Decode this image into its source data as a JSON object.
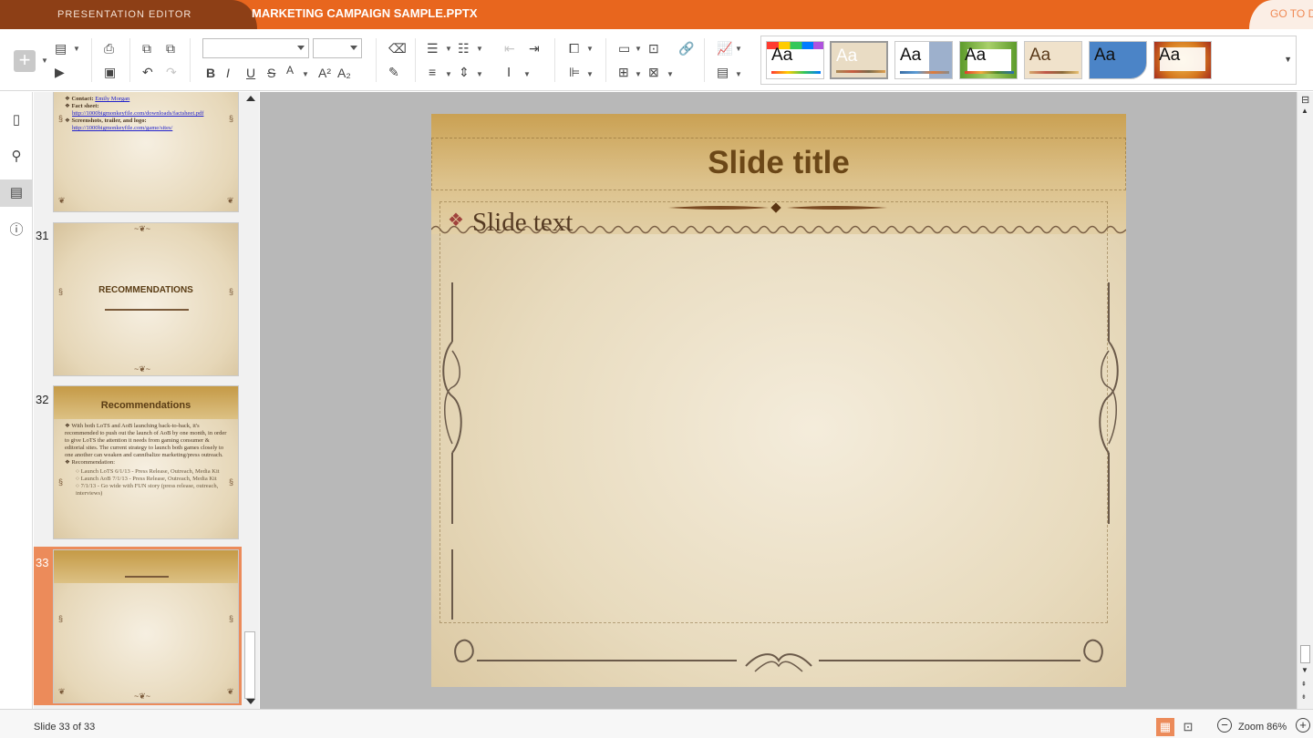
{
  "app": {
    "name": "PRESENTATION EDITOR",
    "document_title": "MARKETING CAMPAIGN SAMPLE.PPTX",
    "goto_label": "GO TO DOCUMENTS"
  },
  "toolbar": {
    "icons": [
      "add-slide",
      "select-layout",
      "start-slideshow",
      "print",
      "save",
      "copy",
      "paste",
      "undo",
      "redo",
      "bold",
      "italic",
      "underline",
      "strikethrough",
      "superscript",
      "subscript",
      "clear-style",
      "copy-style",
      "bullets",
      "numbering",
      "decrease-indent",
      "increase-indent",
      "align-left",
      "vertical-align",
      "line-spacing",
      "shape",
      "text-box",
      "hyperlink",
      "arrange",
      "align-shape",
      "table",
      "image",
      "chart",
      "slide-size"
    ],
    "font_name": "",
    "font_size": ""
  },
  "themes": [
    {
      "label": "Aa",
      "name": "blank",
      "bg": "#ffffff",
      "accent": "#ff3b30"
    },
    {
      "label": "Aa",
      "name": "pixel",
      "bg": "#e9dcc4",
      "accent": "#a98b57",
      "selected": true
    },
    {
      "label": "Aa",
      "name": "classic",
      "bg": "#dde4ee",
      "accent": "#3a6ea5"
    },
    {
      "label": "Aa",
      "name": "green-leaf",
      "bg": "#8cbf4a",
      "accent": "#e03b2b"
    },
    {
      "label": "Aa",
      "name": "lines",
      "bg": "#f0e2cb",
      "accent": "#d4a86c"
    },
    {
      "label": "Aa",
      "name": "blue-wave",
      "bg": "#4b84c7",
      "accent": "#2b5d9b"
    },
    {
      "label": "Aa",
      "name": "autumn",
      "bg": "#d5771e",
      "accent": "#a72d1e"
    }
  ],
  "rail": {
    "icons": [
      "file-icon",
      "search-icon",
      "slides-icon",
      "info-icon"
    ]
  },
  "thumbnails": [
    {
      "number": "",
      "contact_label": "Contact:",
      "contact_name": "Emily Morgan",
      "factsheet_label": "Fact sheet:",
      "factsheet_link": "http://1000bigmonkeyfile.com/downloads/factsheet.pdf",
      "screens_label": "Screenshots, trailer, and logo:",
      "screens_link": "http://1000bigmonkeyfile.com/game/sites/"
    },
    {
      "number": "31",
      "title": "RECOMMENDATIONS"
    },
    {
      "number": "32",
      "title": "Recommendations",
      "body": "With both LoTS and AoB launching back-to-back, it's recommended to push out the launch of AoB by one month, in order to give LoTS the attention it needs from gaming consumer & editorial sites. The current strategy to launch both games closely to one another can weaken and cannibalize marketing/press outreach.",
      "subhead": "Recommendation:",
      "items": [
        "Launch LoTS 6/1/13 - Press Release, Outreach, Media Kit",
        "Launch AoB 7/1/13 - Press Release, Outreach, Media Kit",
        "7/1/13 - Go wide with FUN story (press release, outreach, interviews)"
      ]
    },
    {
      "number": "33",
      "selected": true
    }
  ],
  "slide": {
    "title": "Slide title",
    "body": "Slide text",
    "bullet": "❖"
  },
  "status": {
    "slide_info": "Slide 33 of 33",
    "zoom_label": "Zoom 86%"
  },
  "colors": {
    "brand_orange": "#e8661e",
    "brand_dark": "#8d3f16",
    "selection": "#ec8b5a"
  }
}
